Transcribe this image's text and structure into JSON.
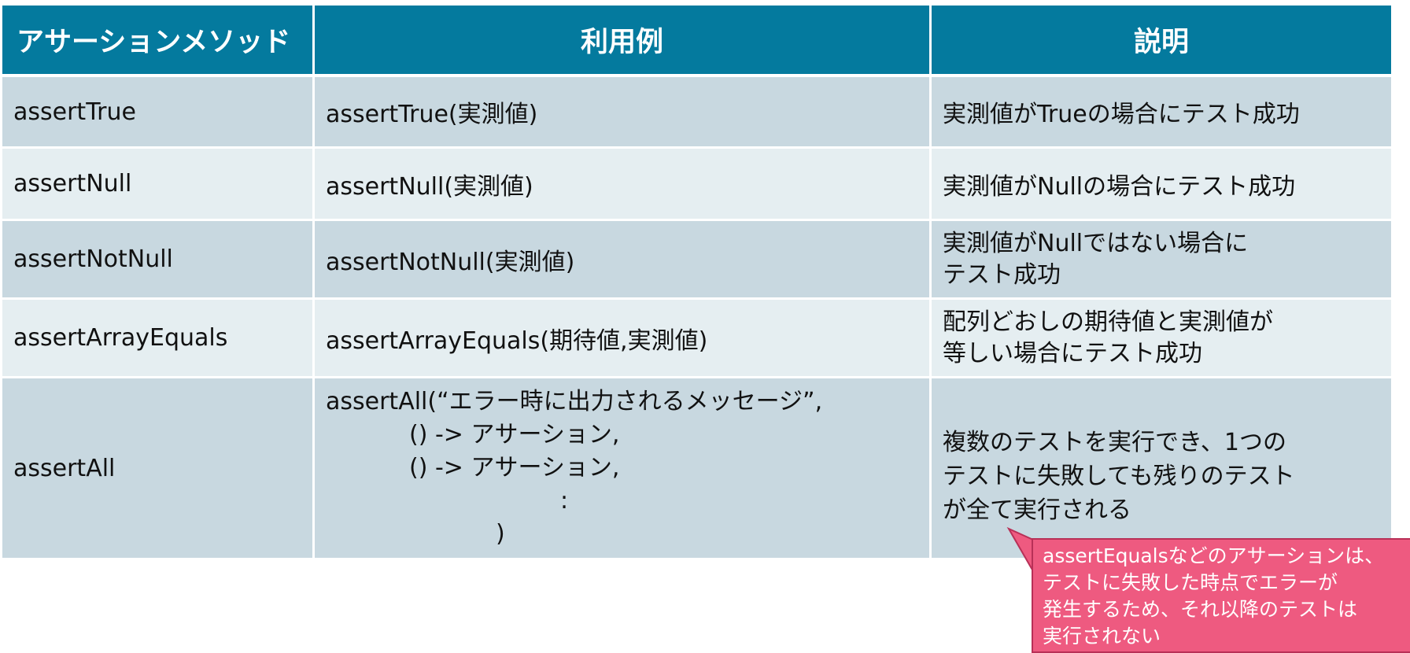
{
  "table": {
    "headers": [
      "アサーションメソッド",
      "利用例",
      "説明"
    ],
    "rows": [
      {
        "method": "assertTrue",
        "example": "assertTrue(実測値)",
        "description": [
          "実測値がTrueの場合にテスト成功"
        ]
      },
      {
        "method": "assertNull",
        "example": "assertNull(実測値)",
        "description": [
          "実測値がNullの場合にテスト成功"
        ]
      },
      {
        "method": "assertNotNull",
        "example": "assertNotNull(実測値)",
        "description": [
          "実測値がNullではない場合に",
          "テスト成功"
        ]
      },
      {
        "method": "assertArrayEquals",
        "example": "assertArrayEquals(期待値,実測値)",
        "description": [
          "配列どおしの期待値と実測値が",
          "等しい場合にテスト成功"
        ]
      },
      {
        "method": "assertAll",
        "example_lines": [
          "assertAll(“エラー時に出力されるメッセージ”,",
          "() -> アサーション,",
          "() -> アサーション,",
          ":",
          ")"
        ],
        "description": [
          "複数のテストを実行でき、1つの",
          "テストに失敗しても残りのテスト",
          "が全て実行される"
        ]
      }
    ]
  },
  "callout": {
    "lines": [
      "assertEqualsなどのアサーションは、",
      "テストに失敗した時点でエラーが",
      "発生するため、それ以降のテストは",
      "実行されない"
    ]
  },
  "colors": {
    "header_bg": "#047a9e",
    "row_dark": "#c8d8e0",
    "row_light": "#e5eef1",
    "callout_bg": "#ee5a80"
  }
}
